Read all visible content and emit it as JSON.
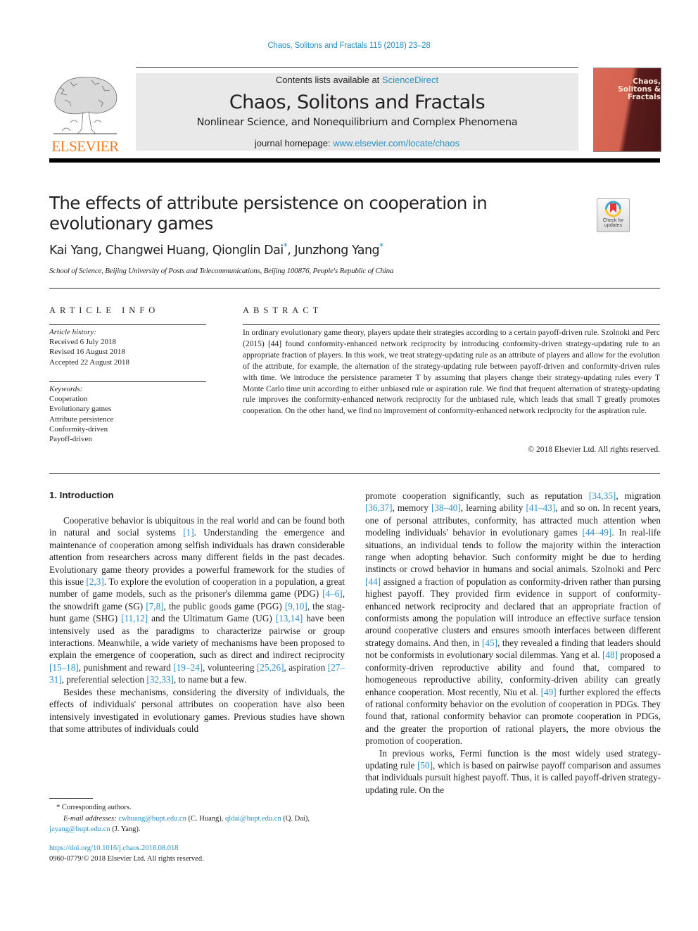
{
  "header": {
    "citation": "Chaos, Solitons and Fractals 115 (2018) 23–28",
    "contents_prefix": "Contents lists available at ",
    "contents_link": "ScienceDirect",
    "journal_title": "Chaos, Solitons and Fractals",
    "journal_subtitle": "Nonlinear Science, and Nonequilibrium and Complex Phenomena",
    "homepage_prefix": "journal homepage: ",
    "homepage_link": "www.elsevier.com/locate/chaos",
    "publisher_logo": "ELSEVIER",
    "cover_title": "Chaos, Solitons & Fractals"
  },
  "article": {
    "title": "The effects of attribute persistence on cooperation in evolutionary games",
    "crossmark_label": "Check for updates",
    "authors": [
      {
        "name": "Kai Yang",
        "corresponding": false
      },
      {
        "name": "Changwei Huang",
        "corresponding": false
      },
      {
        "name": "Qionglin Dai",
        "corresponding": true
      },
      {
        "name": "Junzhong Yang",
        "corresponding": true
      }
    ],
    "author_sep_1": ", ",
    "author_sep_2": ", ",
    "author_sep_3": ", ",
    "corresponding_mark": "*",
    "affiliation": "School of Science, Beijing University of Posts and Telecommunications, Beijing 100876, People's Republic of China"
  },
  "article_info": {
    "label": "ARTICLE INFO",
    "history_header": "Article history:",
    "history": [
      "Received 6 July 2018",
      "Revised 16 August 2018",
      "Accepted 22 August 2018"
    ],
    "keywords_header": "Keywords:",
    "keywords": [
      "Cooperation",
      "Evolutionary games",
      "Attribute persistence",
      "Conformity-driven",
      "Payoff-driven"
    ]
  },
  "abstract": {
    "label": "ABSTRACT",
    "text": "In ordinary evolutionary game theory, players update their strategies according to a certain payoff-driven rule. Szolnoki and Perc (2015) [44] found conformity-enhanced network reciprocity by introducing conformity-driven strategy-updating rule to an appropriate fraction of players. In this work, we treat strategy-updating rule as an attribute of players and allow for the evolution of the attribute, for example, the alternation of the strategy-updating rule between payoff-driven and conformity-driven rules with time. We introduce the persistence parameter T by assuming that players change their strategy-updating rules every T Monte Carlo time unit according to either unbiased rule or aspiration rule. We find that frequent alternation of strategy-updating rule improves the conformity-enhanced network reciprocity for the unbiased rule, which leads that small T greatly promotes cooperation. On the other hand, we find no improvement of conformity-enhanced network reciprocity for the aspiration rule.",
    "copyright": "© 2018 Elsevier Ltd. All rights reserved."
  },
  "body": {
    "section_heading": "1. Introduction",
    "left_paragraphs": [
      [
        {
          "t": "Cooperative behavior is ubiquitous in the real world and can be found both in natural and social systems "
        },
        {
          "ref": "[1]"
        },
        {
          "t": ". Understanding the emergence and maintenance of cooperation among selfish individuals has drawn considerable attention from researchers across many different fields in the past decades. Evolutionary game theory provides a powerful framework for the studies of this issue "
        },
        {
          "ref": "[2,3]"
        },
        {
          "t": ". To explore the evolution of cooperation in a population, a great number of game models, such as the prisoner's dilemma game (PDG) "
        },
        {
          "ref": "[4–6]"
        },
        {
          "t": ", the snowdrift game (SG) "
        },
        {
          "ref": "[7,8]"
        },
        {
          "t": ", the public goods game (PGG) "
        },
        {
          "ref": "[9,10]"
        },
        {
          "t": ", the stag-hunt game (SHG) "
        },
        {
          "ref": "[11,12]"
        },
        {
          "t": " and the Ultimatum Game (UG) "
        },
        {
          "ref": "[13,14]"
        },
        {
          "t": " have been intensively used as the paradigms to characterize pairwise or group interactions. Meanwhile, a wide variety of mechanisms have been proposed to explain the emergence of cooperation, such as direct and indirect reciprocity "
        },
        {
          "ref": "[15–18]"
        },
        {
          "t": ", punishment and reward "
        },
        {
          "ref": "[19–24]"
        },
        {
          "t": ", volunteering "
        },
        {
          "ref": "[25,26]"
        },
        {
          "t": ", aspiration "
        },
        {
          "ref": "[27–31]"
        },
        {
          "t": ", preferential selection "
        },
        {
          "ref": "[32,33]"
        },
        {
          "t": ", to name but a few."
        }
      ],
      [
        {
          "t": "Besides these mechanisms, considering the diversity of individuals, the effects of individuals' personal attributes on cooperation have also been intensively investigated in evolutionary games. Previous studies have shown that some attributes of individuals could"
        }
      ]
    ],
    "right_paragraphs": [
      [
        {
          "t": "promote cooperation significantly, such as reputation "
        },
        {
          "ref": "[34,35]"
        },
        {
          "t": ", migration "
        },
        {
          "ref": "[36,37]"
        },
        {
          "t": ", memory "
        },
        {
          "ref": "[38–40]"
        },
        {
          "t": ", learning ability "
        },
        {
          "ref": "[41–43]"
        },
        {
          "t": ", and so on. In recent years, one of personal attributes, conformity, has attracted much attention when modeling individuals' behavior in evolutionary games "
        },
        {
          "ref": "[44–49]"
        },
        {
          "t": ". In real-life situations, an individual tends to follow the majority within the interaction range when adopting behavior. Such conformity might be due to herding instincts or crowd behavior in humans and social animals. Szolnoki and Perc "
        },
        {
          "ref": "[44]"
        },
        {
          "t": " assigned a fraction of population as conformity-driven rather than pursing highest payoff. They provided firm evidence in support of conformity-enhanced network reciprocity and declared that an appropriate fraction of conformists among the population will introduce an effective surface tension around cooperative clusters and ensures smooth interfaces between different strategy domains. And then, in "
        },
        {
          "ref": "[45]"
        },
        {
          "t": ", they revealed a finding that leaders should not be conformists in evolutionary social dilemmas. Yang et al. "
        },
        {
          "ref": "[48]"
        },
        {
          "t": " proposed a conformity-driven reproductive ability and found that, compared to homogeneous reproductive ability, conformity-driven ability can greatly enhance cooperation. Most recently, Niu et al. "
        },
        {
          "ref": "[49]"
        },
        {
          "t": " further explored the effects of rational conformity behavior on the evolution of cooperation in PDGs. They found that, rational conformity behavior can promote cooperation in PDGs, and the greater the proportion of rational players, the more obvious the promotion of cooperation."
        }
      ],
      [
        {
          "t": "In previous works, Fermi function is the most widely used strategy-updating rule "
        },
        {
          "ref": "[50]"
        },
        {
          "t": ", which is based on pairwise payoff comparison and assumes that individuals pursuit highest payoff. Thus, it is called payoff-driven strategy-updating rule. On the"
        }
      ]
    ]
  },
  "footnotes": {
    "corresponding": "* Corresponding authors.",
    "email_label": "E-mail addresses:",
    "emails": [
      {
        "address": "cwhuang@bupt.edu.cn",
        "who": " (C. Huang), "
      },
      {
        "address": "qldai@bupt.edu.cn",
        "who": " (Q. Dai),"
      },
      {
        "address": "jzyang@bupt.edu.cn",
        "who": " (J. Yang)."
      }
    ],
    "doi": "https://doi.org/10.1016/j.chaos.2018.08.018",
    "issn_copyright": "0960-0779/© 2018 Elsevier Ltd. All rights reserved."
  },
  "colors": {
    "link": "#2b8fc4",
    "elsevier_orange": "#f07d23",
    "masthead_bg": "#e9e9e9",
    "text": "#231f20"
  }
}
